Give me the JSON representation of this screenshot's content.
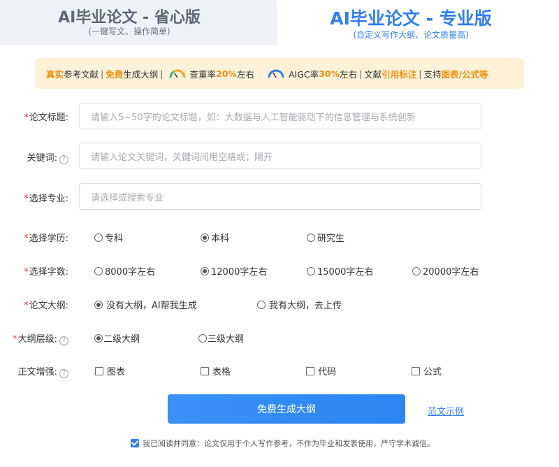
{
  "tabs": {
    "left": {
      "title": "AI毕业论文 - 省心版",
      "subtitle": "(一键写文、操作简单)"
    },
    "right": {
      "title": "AI毕业论文 - 专业版",
      "subtitle": "(自定义写作大纲、论文质量高)"
    }
  },
  "banner": {
    "p1_a": "真实",
    "p1_b": "参考文献",
    "p2_a": "免费",
    "p2_b": "生成大纲",
    "p3_a": "查重率",
    "p3_b": "20%",
    "p3_c": "左右",
    "p4_a": "AIGC率",
    "p4_b": "30%",
    "p4_c": " 左右",
    "p5_a": "文献",
    "p5_b": "引用标注",
    "p6_a": "支持",
    "p6_b": "图表/公式等",
    "sep": "|",
    "gauge_colors": {
      "green": "#3cb371",
      "orange": "#f5a623",
      "blue": "#2f7df6"
    }
  },
  "form": {
    "title": {
      "label": "论文标题:",
      "placeholder": "请输入5~50字的论文标题，如：大数据与人工智能驱动下的信息管理与系统创新"
    },
    "keywords": {
      "label": "关键词:",
      "placeholder": "请输入论文关键词，关键词间用空格或；隔开"
    },
    "major": {
      "label": "选择专业:",
      "placeholder": "请选择或搜索专业"
    },
    "degree": {
      "label": "选择学历:",
      "options": [
        "专科",
        "本科",
        "研究生"
      ],
      "selected": 1
    },
    "wordcount": {
      "label": "选择字数:",
      "options": [
        "8000字左右",
        "12000字左右",
        "15000字左右",
        "20000字左右"
      ],
      "selected": 1
    },
    "outline": {
      "label": "论文大纲:",
      "options": [
        "没有大纲，AI帮我生成",
        "我有大纲，去上传"
      ],
      "selected": 0
    },
    "outline_level": {
      "label": "大纲层级:",
      "options": [
        "二级大纲",
        "三级大纲"
      ],
      "selected": 0
    },
    "enhance": {
      "label": "正文增强:",
      "options": [
        "图表",
        "表格",
        "代码",
        "公式"
      ]
    },
    "required_mark": "*",
    "help_mark": "?"
  },
  "actions": {
    "submit_label": "免费生成大纲",
    "example_link": "范文示例"
  },
  "agreement": {
    "checked": true,
    "text": "我已阅读并同意：论文仅用于个人写作参考，不作为毕业和发表使用，严守学术诚信。"
  },
  "colors": {
    "accent": "#2f7df6",
    "banner_bg": "#fdf1d8",
    "highlight": "#f0900e",
    "required": "#e53935"
  }
}
